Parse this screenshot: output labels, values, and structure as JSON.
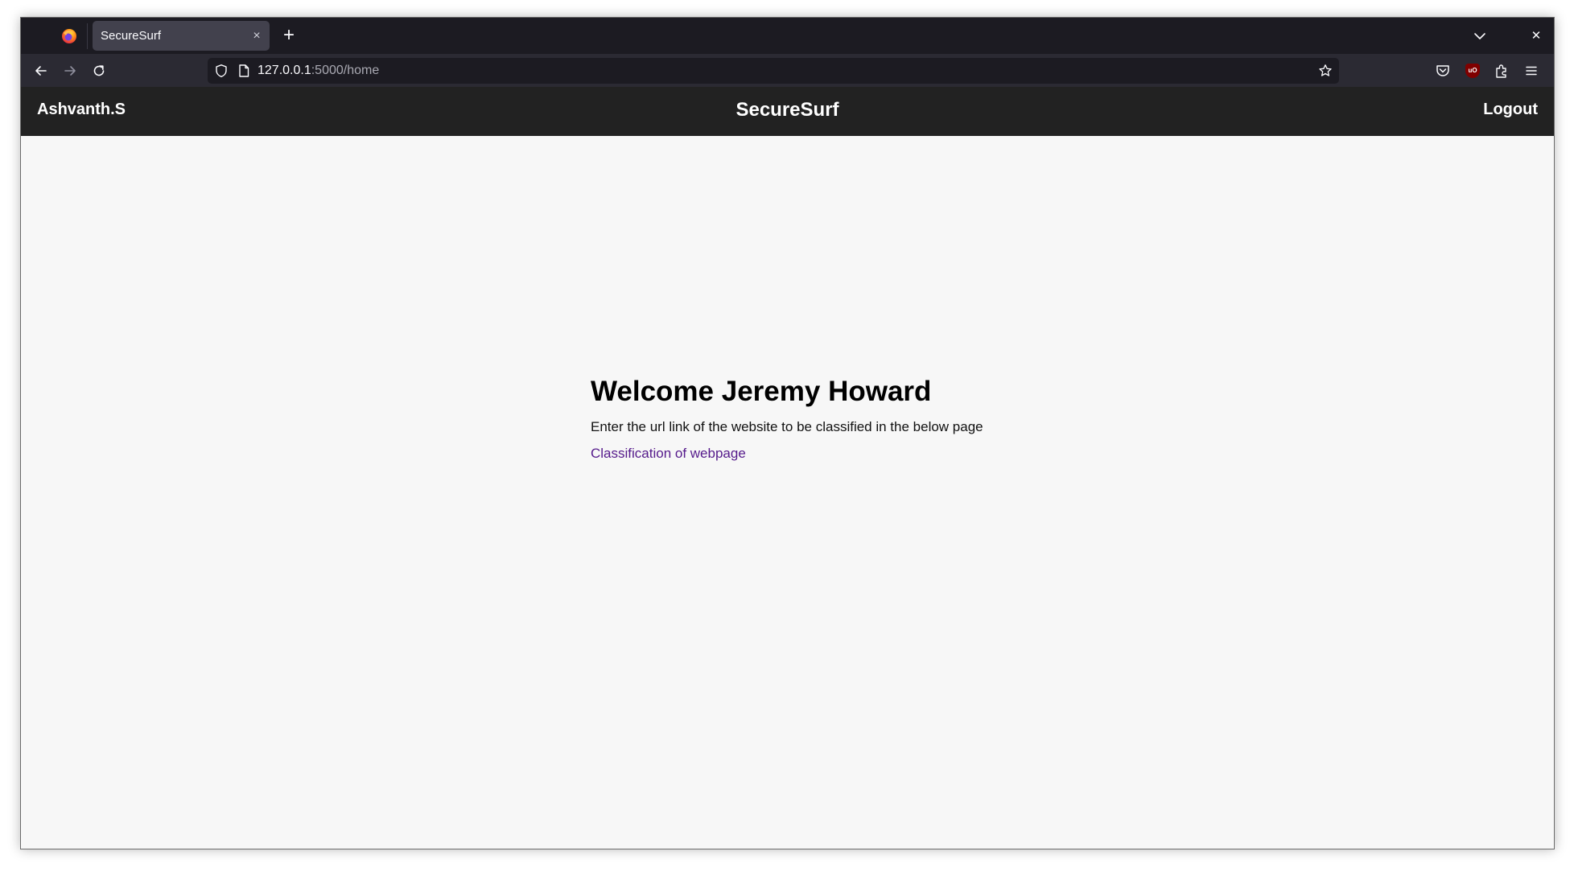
{
  "browser": {
    "tab": {
      "title": "SecureSurf",
      "close_glyph": "×"
    },
    "new_tab_glyph": "+",
    "window_close_glyph": "✕",
    "url": {
      "host": "127.0.0.1",
      "rest": ":5000/home"
    },
    "ublock_badge": "uO",
    "icons": [
      "firefox-logo-icon",
      "chevron-down-icon",
      "back-arrow-icon",
      "forward-arrow-icon",
      "reload-icon",
      "shield-icon",
      "page-icon",
      "star-icon",
      "pocket-icon",
      "ublock-icon",
      "extensions-icon",
      "menu-icon"
    ]
  },
  "site": {
    "user_name": "Ashvanth.S",
    "brand": "SecureSurf",
    "logout_label": "Logout"
  },
  "main": {
    "welcome": "Welcome Jeremy Howard",
    "instructions": "Enter the url link of the website to be classified in the below page",
    "link_label": "Classification of webpage"
  },
  "colors": {
    "header_bg": "#222222",
    "page_bg": "#f7f7f7",
    "visited_link": "#551a8b",
    "tabstrip_bg": "#1c1b22",
    "navbar_bg": "#2b2a33"
  }
}
